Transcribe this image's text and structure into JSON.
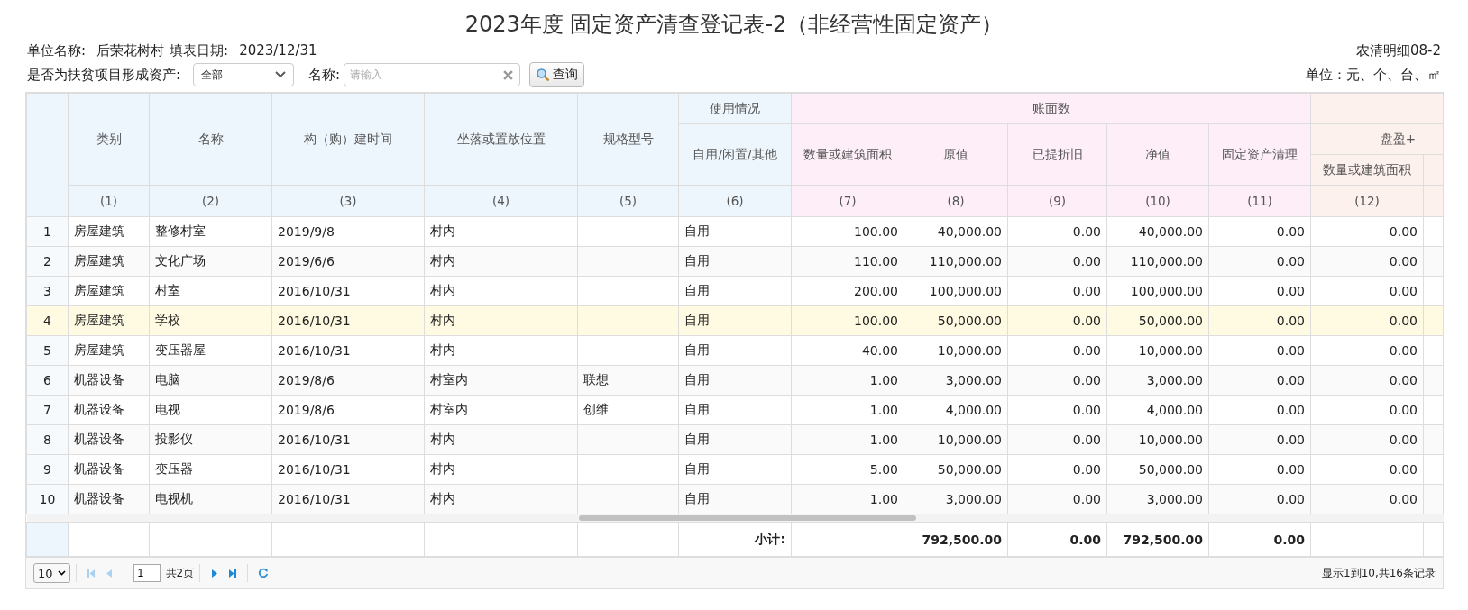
{
  "title": "2023年度 固定资产清查登记表-2（非经营性固定资产）",
  "info": {
    "unit_label": "单位名称:",
    "unit_value": "后荣花树村",
    "date_label": "填表日期:",
    "date_value": "2023/12/31",
    "form_code": "农清明细08-2",
    "unit_note": "单位：元、个、台、㎡"
  },
  "filters": {
    "poverty_label": "是否为扶贫项目形成资产:",
    "poverty_value": "全部",
    "name_label": "名称:",
    "name_placeholder": "请输入",
    "query_button": "查询"
  },
  "header": {
    "usage_group": "使用情况",
    "book_group": "账面数",
    "surplus_group": "盘盈+",
    "columns": [
      {
        "label": "类别",
        "no": "(1)"
      },
      {
        "label": "名称",
        "no": "(2)"
      },
      {
        "label": "构（购）建时间",
        "no": "(3)"
      },
      {
        "label": "坐落或置放位置",
        "no": "(4)"
      },
      {
        "label": "规格型号",
        "no": "(5)"
      },
      {
        "label": "自用/闲置/其他",
        "no": "(6)"
      },
      {
        "label": "数量或建筑面积",
        "no": "(7)"
      },
      {
        "label": "原值",
        "no": "(8)"
      },
      {
        "label": "已提折旧",
        "no": "(9)"
      },
      {
        "label": "净值",
        "no": "(10)"
      },
      {
        "label": "固定资产清理",
        "no": "(11)"
      },
      {
        "label": "数量或建筑面积",
        "no": "(12)"
      }
    ]
  },
  "rows": [
    {
      "no": "1",
      "highlighted": false,
      "cells": [
        "房屋建筑",
        "整修村室",
        "2019/9/8",
        "村内",
        "",
        "自用",
        "100.00",
        "40,000.00",
        "0.00",
        "40,000.00",
        "0.00",
        "0.00"
      ]
    },
    {
      "no": "2",
      "highlighted": false,
      "cells": [
        "房屋建筑",
        "文化广场",
        "2019/6/6",
        "村内",
        "",
        "自用",
        "110.00",
        "110,000.00",
        "0.00",
        "110,000.00",
        "0.00",
        "0.00"
      ]
    },
    {
      "no": "3",
      "highlighted": false,
      "cells": [
        "房屋建筑",
        "村室",
        "2016/10/31",
        "村内",
        "",
        "自用",
        "200.00",
        "100,000.00",
        "0.00",
        "100,000.00",
        "0.00",
        "0.00"
      ]
    },
    {
      "no": "4",
      "highlighted": true,
      "cells": [
        "房屋建筑",
        "学校",
        "2016/10/31",
        "村内",
        "",
        "自用",
        "100.00",
        "50,000.00",
        "0.00",
        "50,000.00",
        "0.00",
        "0.00"
      ]
    },
    {
      "no": "5",
      "highlighted": false,
      "cells": [
        "房屋建筑",
        "变压器屋",
        "2016/10/31",
        "村内",
        "",
        "自用",
        "40.00",
        "10,000.00",
        "0.00",
        "10,000.00",
        "0.00",
        "0.00"
      ]
    },
    {
      "no": "6",
      "highlighted": false,
      "cells": [
        "机器设备",
        "电脑",
        "2019/8/6",
        "村室内",
        "联想",
        "自用",
        "1.00",
        "3,000.00",
        "0.00",
        "3,000.00",
        "0.00",
        "0.00"
      ]
    },
    {
      "no": "7",
      "highlighted": false,
      "cells": [
        "机器设备",
        "电视",
        "2019/8/6",
        "村室内",
        "创维",
        "自用",
        "1.00",
        "4,000.00",
        "0.00",
        "4,000.00",
        "0.00",
        "0.00"
      ]
    },
    {
      "no": "8",
      "highlighted": false,
      "cells": [
        "机器设备",
        "投影仪",
        "2016/10/31",
        "村内",
        "",
        "自用",
        "1.00",
        "10,000.00",
        "0.00",
        "10,000.00",
        "0.00",
        "0.00"
      ]
    },
    {
      "no": "9",
      "highlighted": false,
      "cells": [
        "机器设备",
        "变压器",
        "2016/10/31",
        "村内",
        "",
        "自用",
        "5.00",
        "50,000.00",
        "0.00",
        "50,000.00",
        "0.00",
        "0.00"
      ]
    },
    {
      "no": "10",
      "highlighted": false,
      "cells": [
        "机器设备",
        "电视机",
        "2016/10/31",
        "村内",
        "",
        "自用",
        "1.00",
        "3,000.00",
        "0.00",
        "3,000.00",
        "0.00",
        "0.00"
      ]
    }
  ],
  "subtotal": {
    "label": "小计:",
    "totals": [
      "792,500.00",
      "0.00",
      "792,500.00",
      "0.00"
    ]
  },
  "pager": {
    "page_size": "10",
    "page": "1",
    "pages": "共2页",
    "summary": "显示1到10,共16条记录",
    "buttons": [
      {
        "kind": "first",
        "disabled": true
      },
      {
        "kind": "prev",
        "disabled": true
      },
      {
        "kind": "next",
        "disabled": false
      },
      {
        "kind": "last",
        "disabled": false
      }
    ]
  }
}
